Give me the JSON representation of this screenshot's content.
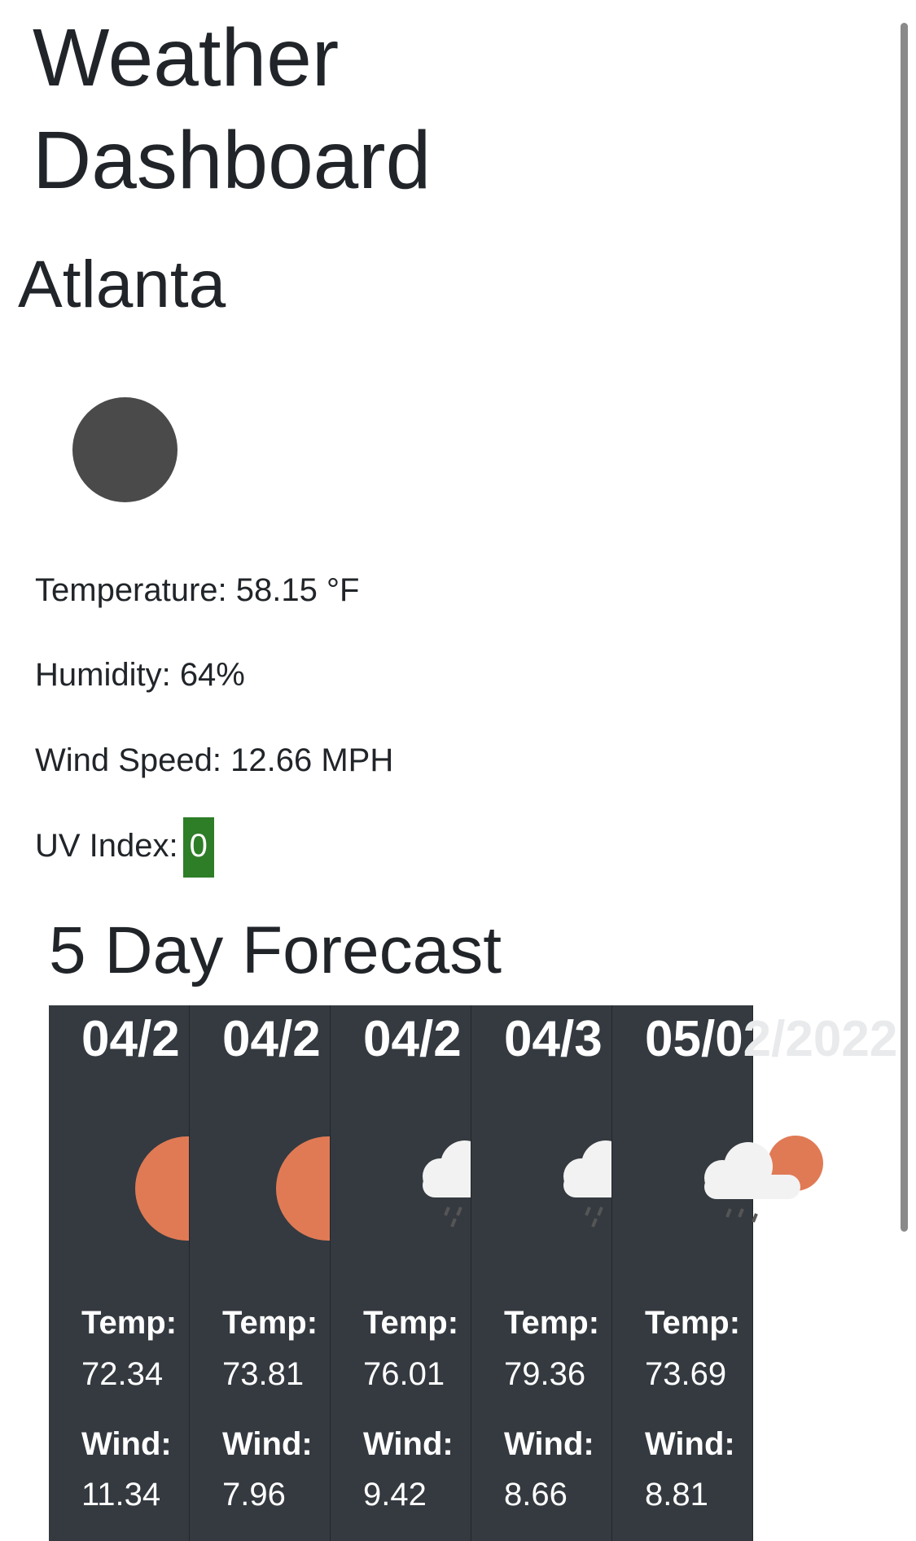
{
  "header": {
    "title": "Weather Dashboard"
  },
  "current": {
    "city": "Atlanta",
    "icon": "night-clear-icon",
    "temperature": "Temperature: 58.15 °F",
    "humidity": "Humidity: 64%",
    "wind": "Wind Speed: 12.66 MPH",
    "uv_label": "UV Index:",
    "uv_value": "0",
    "uv_color": "#2e7d27"
  },
  "forecast": {
    "title": "5 Day Forecast",
    "temp_label": "Temp:",
    "wind_label": "Wind:",
    "days": [
      {
        "date": "04/2",
        "icon": "sun-icon",
        "temp": "72.34",
        "wind": "11.34"
      },
      {
        "date": "04/2",
        "icon": "sun-icon",
        "temp": "73.81",
        "wind": "7.96"
      },
      {
        "date": "04/2",
        "icon": "rain-cloud-icon",
        "temp": "76.01",
        "wind": "9.42"
      },
      {
        "date": "04/3",
        "icon": "rain-cloud-icon",
        "temp": "79.36",
        "wind": "8.66"
      },
      {
        "date": "05/0",
        "date_overflow": "2/2022",
        "icon": "rain-cloud-sun-icon",
        "temp": "73.69",
        "wind": "8.81"
      }
    ]
  },
  "colors": {
    "card_bg": "#343a40",
    "sun": "#e07a55",
    "cloud": "#f2f2f2",
    "moon": "#4a4a4a"
  }
}
